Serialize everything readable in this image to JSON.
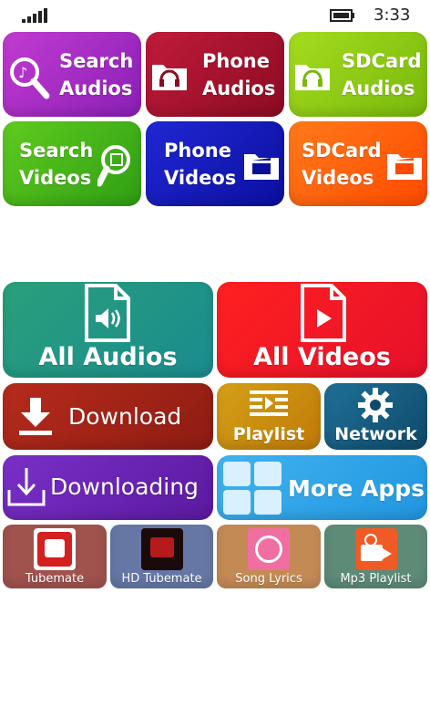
{
  "status": {
    "time": "3:33"
  },
  "tiles": {
    "search_audios": "Search\nAudios",
    "phone_audios": "Phone\nAudios",
    "sdcard_audios": "SDCard\nAudios",
    "search_videos": "Search\nVideos",
    "phone_videos": "Phone\nVideos",
    "sdcard_videos": "SDCard\nVideos",
    "all_audios": "All Audios",
    "all_videos": "All Videos",
    "download": "Download",
    "playlist": "Playlist",
    "network": "Network",
    "downloading": "Downloading",
    "more_apps": "More Apps"
  },
  "apps": [
    {
      "label": "Tubemate",
      "icon": "tubemate-icon"
    },
    {
      "label": "HD Tubemate",
      "icon": "hd-tubemate-icon"
    },
    {
      "label": "Song Lyrics",
      "icon": "song-lyrics-icon"
    },
    {
      "label": "Mp3 Playlist",
      "icon": "mp3-playlist-icon"
    }
  ]
}
